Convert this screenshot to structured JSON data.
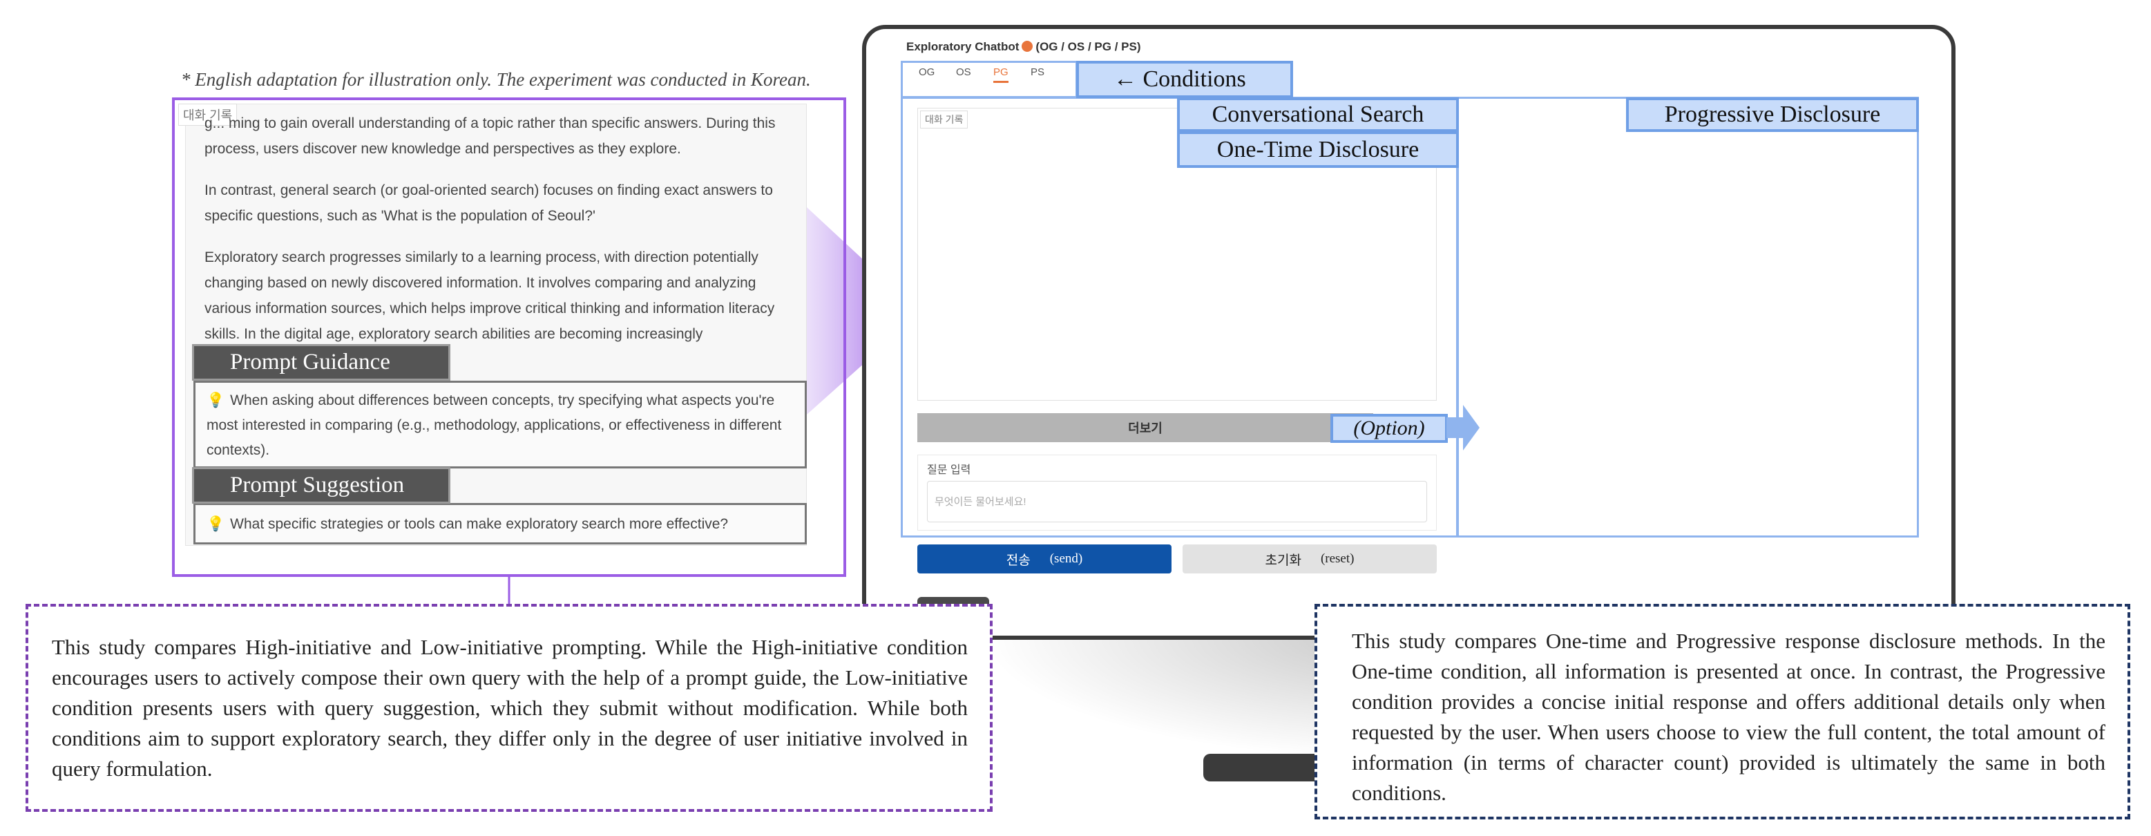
{
  "note": "* English adaptation for illustration only. The experiment was conducted in Korean.",
  "left_panel": {
    "chat_tag": "대화 기록",
    "paragraphs": [
      "g... ming to gain overall understanding of a topic rather than specific answers. During this process, users discover new knowledge and perspectives as they explore.",
      "In contrast, general search (or goal-oriented search) focuses on finding exact answers to specific questions, such as 'What is the population of Seoul?'",
      "Exploratory search progresses similarly to a learning process, with direction potentially changing based on newly discovered information. It involves comparing and analyzing various information sources, which helps improve critical thinking and information literacy skills. In the digital age, exploratory search abilities are becoming increasingly"
    ],
    "prompt_guidance_label": "Prompt Guidance",
    "prompt_guidance_text": "When asking about differences between concepts, try specifying what aspects you're most interested in comparing (e.g., methodology, applications, or effectiveness in different contexts).",
    "prompt_suggestion_label": "Prompt Suggestion",
    "prompt_suggestion_text": "What specific strategies or tools can make exploratory search more effective?",
    "bulb_icon": "💡"
  },
  "app": {
    "title": "Exploratory Chatbot",
    "title_suffix": "(OG / OS / PG / PS)",
    "tabs": [
      "OG",
      "OS",
      "PG",
      "PS"
    ],
    "active_tab": "PG",
    "chat_tag": "대화 기록",
    "more_label": "더보기",
    "input_label": "질문 입력",
    "input_placeholder": "무엇이든 물어보세요!",
    "send_label": "전송",
    "send_en": "(send)",
    "reset_label": "초기화",
    "reset_en": "(reset)"
  },
  "annotations": {
    "conditions": "← Conditions",
    "conversational_search": "Conversational Search",
    "one_time_disclosure": "One-Time Disclosure",
    "progressive_disclosure": "Progressive Disclosure",
    "option": "(Option)"
  },
  "descriptions": {
    "left": "This study compares High-initiative and Low-initiative prompting. While the High-initiative condition encourages users to actively compose their own query with the help of a prompt guide, the Low-initiative condition presents users with query suggestion, which they submit without modification. While both conditions aim to support exploratory search, they differ only in the degree of user initiative involved in query formulation.",
    "right": "This study compares One-time and Progressive response disclosure methods. In the One-time condition, all information is presented at once. In contrast, the Progressive condition provides a concise initial response and offers additional details only when requested by the user. When users choose to view the full content, the total amount of information (in terms of character count) provided is ultimately the same in both conditions."
  },
  "colors": {
    "purple": "#9b5de5",
    "purple_dashed": "#7a3fb0",
    "blue_frame": "#8fb4ee",
    "blue_label_fill": "#c8dcfa",
    "navy_dashed": "#1f3563",
    "send_button": "#0f54a8",
    "active_tab": "#e8743b"
  }
}
